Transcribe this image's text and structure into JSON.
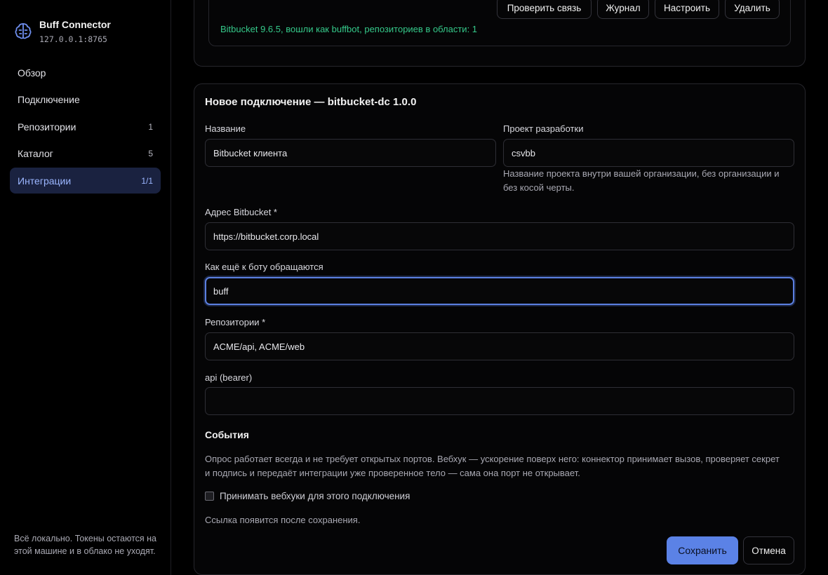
{
  "brand": {
    "name": "Buff Connector",
    "address": "127.0.0.1:8765"
  },
  "sidebar": {
    "items": [
      {
        "label": "Обзор",
        "count": ""
      },
      {
        "label": "Подключение",
        "count": ""
      },
      {
        "label": "Репозитории",
        "count": "1"
      },
      {
        "label": "Каталог",
        "count": "5"
      },
      {
        "label": "Интеграции",
        "count": "1/1",
        "active": true
      }
    ],
    "footer": "Всё локально. Токены остаются на этой машине и в облако не уходят."
  },
  "existing": {
    "buttons": {
      "check": "Проверить связь",
      "log": "Журнал",
      "configure": "Настроить",
      "delete": "Удалить"
    },
    "status": "Bitbucket 9.6.5, вошли как buffbot, репозиториев в области: 1"
  },
  "form": {
    "title": "Новое подключение — bitbucket-dc 1.0.0",
    "name_label": "Название",
    "name_value": "Bitbucket клиента",
    "project_label": "Проект разработки",
    "project_value": "csvbb",
    "project_hint": "Название проекта внутри вашей организации, без организации и без косой черты.",
    "url_label": "Адрес Bitbucket *",
    "url_value": "https://bitbucket.corp.local",
    "alias_label": "Как ещё к боту обращаются",
    "alias_value": "buff",
    "repos_label": "Репозитории *",
    "repos_value": "ACME/api, ACME/web",
    "token_label": "api (bearer)",
    "token_value": "",
    "events_title": "События",
    "events_desc": "Опрос работает всегда и не требует открытых портов. Вебхук — ускорение поверх него: коннектор принимает вызов, проверяет секрет и подпись и передаёт интеграции уже проверенное тело — сама она порт не открывает.",
    "webhook_label": "Принимать вебхуки для этого подключения",
    "link_note": "Ссылка появится после сохранения.",
    "save_label": "Сохранить",
    "cancel_label": "Отмена"
  },
  "colors": {
    "accent": "#5b82e6",
    "success": "#35c98a",
    "active_nav_bg": "#1a2240"
  }
}
